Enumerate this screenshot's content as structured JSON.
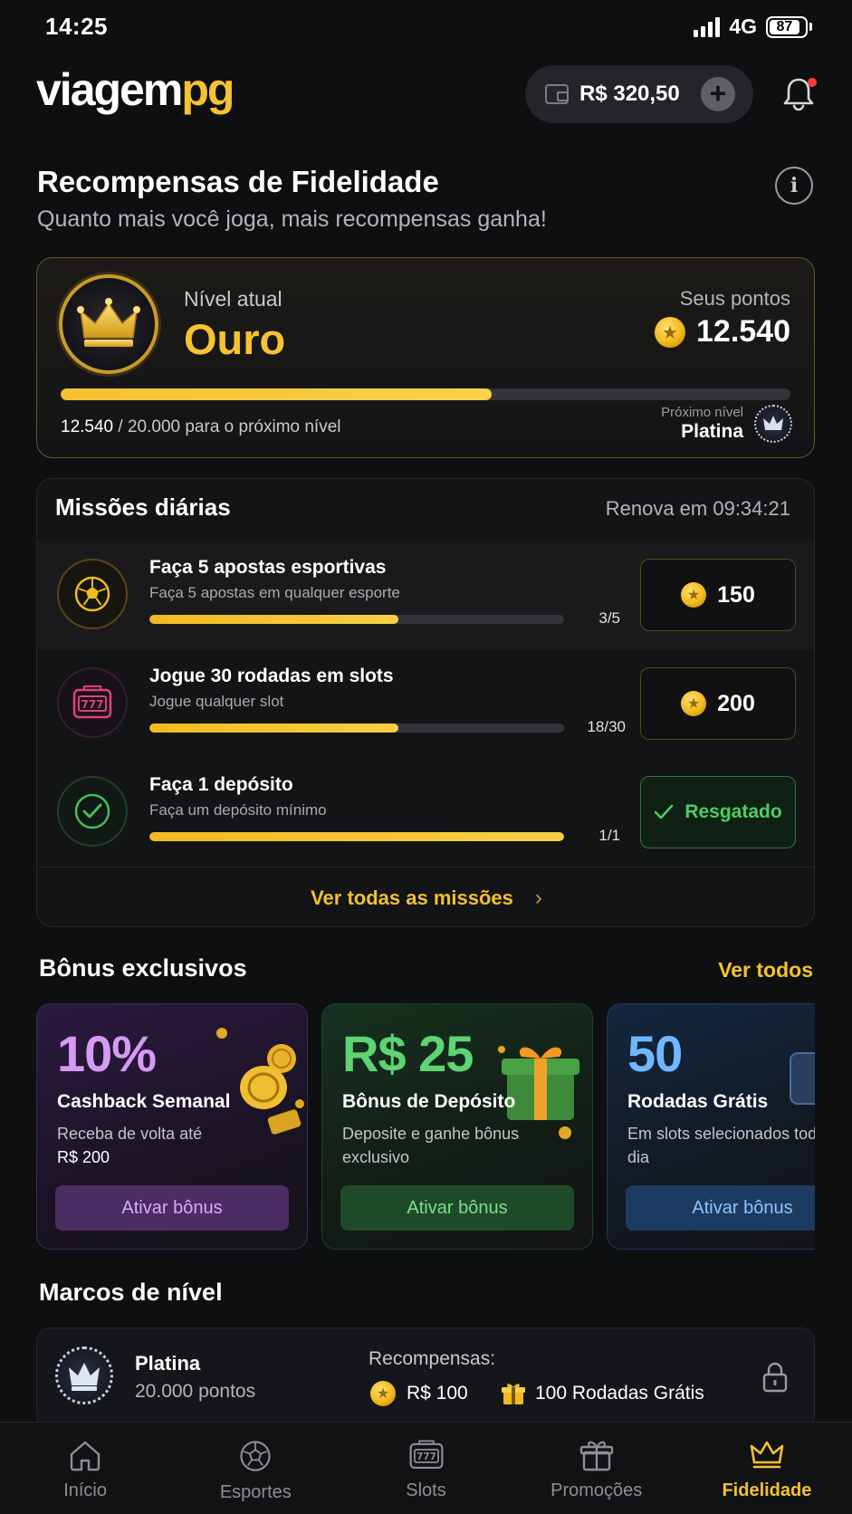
{
  "status_bar": {
    "time": "14:25",
    "network": "4G",
    "battery": "87"
  },
  "header": {
    "logo_left": "viagem",
    "logo_right": "pg",
    "balance": "R$ 320,50"
  },
  "page": {
    "title": "Recompensas de Fidelidade",
    "subtitle": "Quanto mais você joga, mais recompensas ganha!"
  },
  "level_card": {
    "current_label": "Nível atual",
    "current_level": "Ouro",
    "points_label": "Seus pontos",
    "points": "12.540",
    "progress_current": "12.540",
    "progress_rest": " / 20.000 para o próximo nível",
    "progress_fraction": 0.59,
    "next_label": "Próximo nível",
    "next_level": "Platina"
  },
  "missions": {
    "title": "Missões diárias",
    "renew": "Renova em 09:34:21",
    "items": [
      {
        "title": "Faça 5 apostas esportivas",
        "desc": "Faça 5 apostas em qualquer esporte",
        "count": "3/5",
        "progress": 0.6,
        "reward": "150",
        "icon": "soccer-ball-icon"
      },
      {
        "title": "Jogue 30 rodadas em slots",
        "desc": "Jogue qualquer slot",
        "count": "18/30",
        "progress": 0.6,
        "reward": "200",
        "icon": "slot-machine-icon"
      },
      {
        "title": "Faça 1 depósito",
        "desc": "Faça um depósito mínimo",
        "count": "1/1",
        "progress": 1.0,
        "reward": "Resgatado",
        "icon": "check-circle-icon"
      }
    ],
    "see_all": "Ver todas as missões"
  },
  "bonus": {
    "title": "Bônus exclusivos",
    "see_all": "Ver todos",
    "cards": [
      {
        "big": "10%",
        "name": "Cashback Semanal",
        "desc": "Receba de volta até",
        "desc2": "R$ 200",
        "button": "Ativar bônus"
      },
      {
        "big": "R$ 25",
        "name": "Bônus de Depósito",
        "desc": "Deposite e ganhe bônus exclusivo",
        "button": "Ativar bônus"
      },
      {
        "big": "50",
        "name": "Rodadas Grátis",
        "desc": "Em slots selecionados todo dia",
        "button": "Ativar bônus"
      }
    ]
  },
  "milestones": {
    "title": "Marcos de nível",
    "items": [
      {
        "name": "Platina",
        "points": "20.000 pontos",
        "rewards_label": "Recompensas:",
        "reward1": "R$ 100",
        "reward2": "100 Rodadas Grátis"
      }
    ]
  },
  "tabs": [
    {
      "label": "Início",
      "icon": "home-icon"
    },
    {
      "label": "Esportes",
      "icon": "soccer-ball-icon"
    },
    {
      "label": "Slots",
      "icon": "slot-machine-icon"
    },
    {
      "label": "Promoções",
      "icon": "gift-icon"
    },
    {
      "label": "Fidelidade",
      "icon": "crown-icon",
      "active": true
    }
  ],
  "colors": {
    "accent": "#f5c232",
    "background": "#0e0f11",
    "success": "#4ccd63",
    "purple": "#d79af4",
    "green": "#5ed475",
    "blue": "#6fb8ff"
  }
}
